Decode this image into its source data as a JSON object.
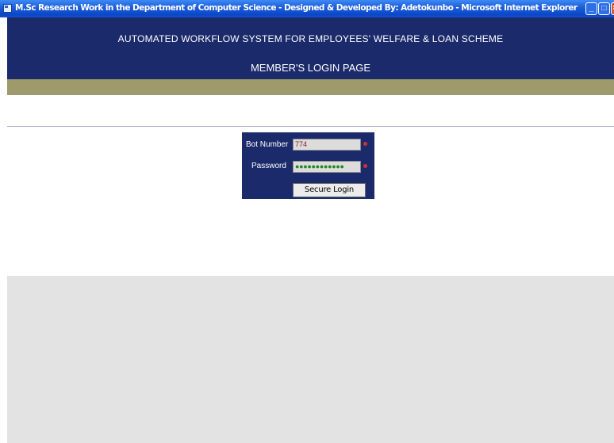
{
  "window": {
    "title": "M.Sc Research Work in the Department of Computer Science - Designed & Developed By: Adetokunbo  - Microsoft Internet Explorer",
    "icon": "ie-window-icon",
    "controls": {
      "minimize": "minimize-icon",
      "maximize": "maximize-icon",
      "close": "close-icon"
    }
  },
  "header": {
    "app_title": "AUTOMATED WORKFLOW SYSTEM FOR EMPLOYEES' WELFARE & LOAN SCHEME",
    "page_title": "MEMBER'S LOGIN PAGE"
  },
  "login": {
    "bot_number_label": "Bot Number",
    "bot_number_value": "774",
    "password_label": "Password",
    "password_value": "●●●●●●●●●●●●",
    "submit_label": "Secure Login"
  },
  "colors": {
    "header_bg": "#1b2a6b",
    "band": "#9e9a6c",
    "required_marker": "#d23030"
  }
}
